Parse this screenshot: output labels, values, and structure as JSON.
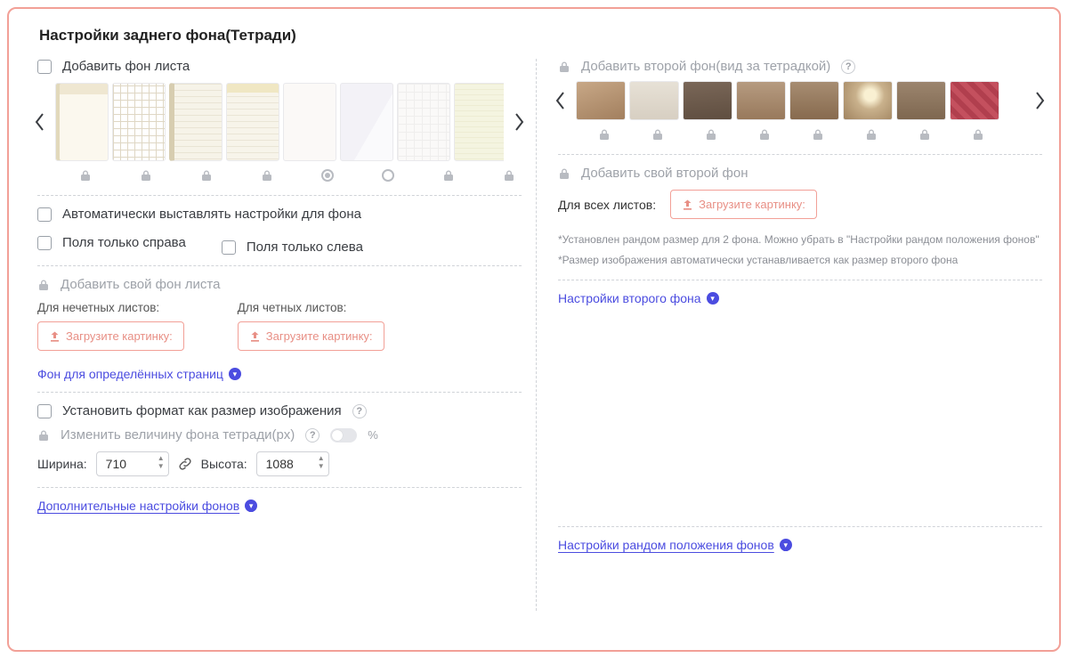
{
  "title": "Настройки заднего фона(Тетради)",
  "left": {
    "add_sheet_bg": "Добавить фон листа",
    "thumb_indicators": [
      "lock",
      "lock",
      "lock",
      "lock",
      "radio_on",
      "radio_off",
      "lock",
      "lock"
    ],
    "auto_settings": "Автоматически выставлять настройки для фона",
    "fields_right": "Поля только справа",
    "fields_left": "Поля только слева",
    "add_own_bg": "Добавить свой фон листа",
    "odd_caption": "Для нечетных листов:",
    "even_caption": "Для четных листов:",
    "upload_label": "Загрузите картинку:",
    "pages_link": "Фон для определённых страниц",
    "set_format": "Установить формат как размер изображения",
    "resize_bg": "Изменить величину фона тетради(px)",
    "percent": "%",
    "width_label": "Ширина:",
    "height_label": "Высота:",
    "width_value": "710",
    "height_value": "1088",
    "more_link": "Дополнительные настройки фонов"
  },
  "right": {
    "add_second_bg": "Добавить второй фон(вид за тетрадкой)",
    "thumb_indicators": [
      "lock",
      "lock",
      "lock",
      "lock",
      "lock",
      "lock",
      "lock",
      "lock"
    ],
    "add_own_second": "Добавить свой второй фон",
    "for_all_caption": "Для всех листов:",
    "upload_label": "Загрузите картинку:",
    "note1": "*Установлен рандом размер для 2 фона. Можно убрать в \"Настройки рандом положения фонов\"",
    "note2": "*Размер изображения автоматически устанавливается как размер второго фона",
    "second_bg_link": "Настройки второго фона",
    "random_link": "Настройки рандом положения фонов"
  }
}
